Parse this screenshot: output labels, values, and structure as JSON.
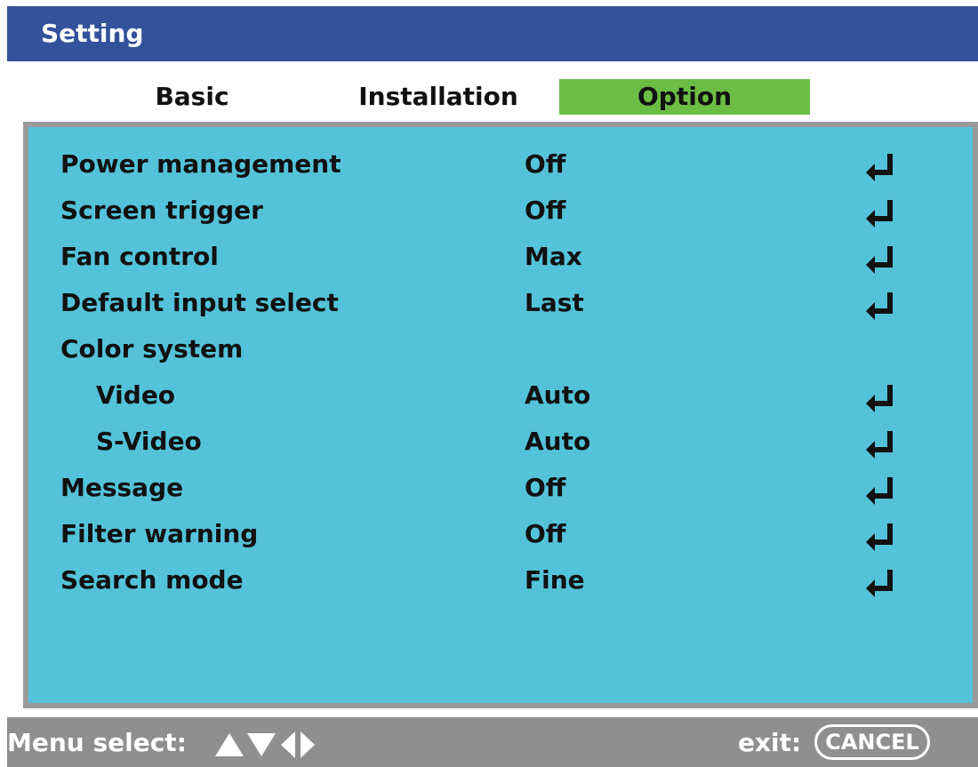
{
  "window": {
    "title": "Setting"
  },
  "tabs": [
    {
      "label": "Basic",
      "active": false
    },
    {
      "label": "Installation",
      "active": false
    },
    {
      "label": "Option",
      "active": true
    }
  ],
  "settings": [
    {
      "label": "Power management",
      "value": "Off"
    },
    {
      "label": "Screen trigger",
      "value": "Off"
    },
    {
      "label": "Fan control",
      "value": "Max"
    },
    {
      "label": "Default input select",
      "value": "Last"
    },
    {
      "label": "Color system"
    },
    {
      "label": "Video",
      "value": "Auto"
    },
    {
      "label": "S-Video",
      "value": "Auto"
    },
    {
      "label": "Message",
      "value": "Off"
    },
    {
      "label": "Filter warning",
      "value": "Off"
    },
    {
      "label": "Search mode",
      "value": "Fine"
    }
  ],
  "footer": {
    "menu_select_label": "Menu select:",
    "exit_label": "exit:",
    "cancel_key": "CANCEL"
  },
  "colors": {
    "title_bar": "#33529b",
    "active_tab": "#6cbd45",
    "panel": "#54c3d9",
    "status_bar": "#8f8f8f"
  },
  "icons": {
    "enter": "enter-arrow-icon",
    "navigation": "up-down-left-right-triangles-icon"
  }
}
